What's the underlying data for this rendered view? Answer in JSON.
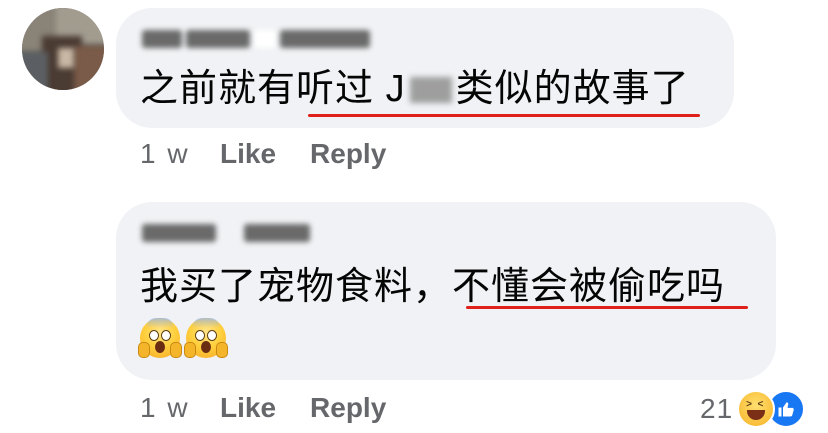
{
  "comments": [
    {
      "text_before": "之前就有",
      "text_underlined_1": "听过 J",
      "text_underlined_2": "类似的故事了",
      "time": "1 w",
      "like_label": "Like",
      "reply_label": "Reply"
    },
    {
      "text_before": "我买了宠物食料，",
      "text_underlined": "不懂会被偷吃吗",
      "emojis": [
        "face-screaming-in-fear",
        "face-screaming-in-fear"
      ],
      "time": "1 w",
      "like_label": "Like",
      "reply_label": "Reply",
      "reaction_count": "21",
      "reaction_icons": [
        "haha-icon",
        "like-icon"
      ]
    }
  ],
  "colors": {
    "bubble": "#f0f2f5",
    "meta_text": "#65676b",
    "underline": "#e0201b",
    "like_blue": "#1877f2"
  }
}
